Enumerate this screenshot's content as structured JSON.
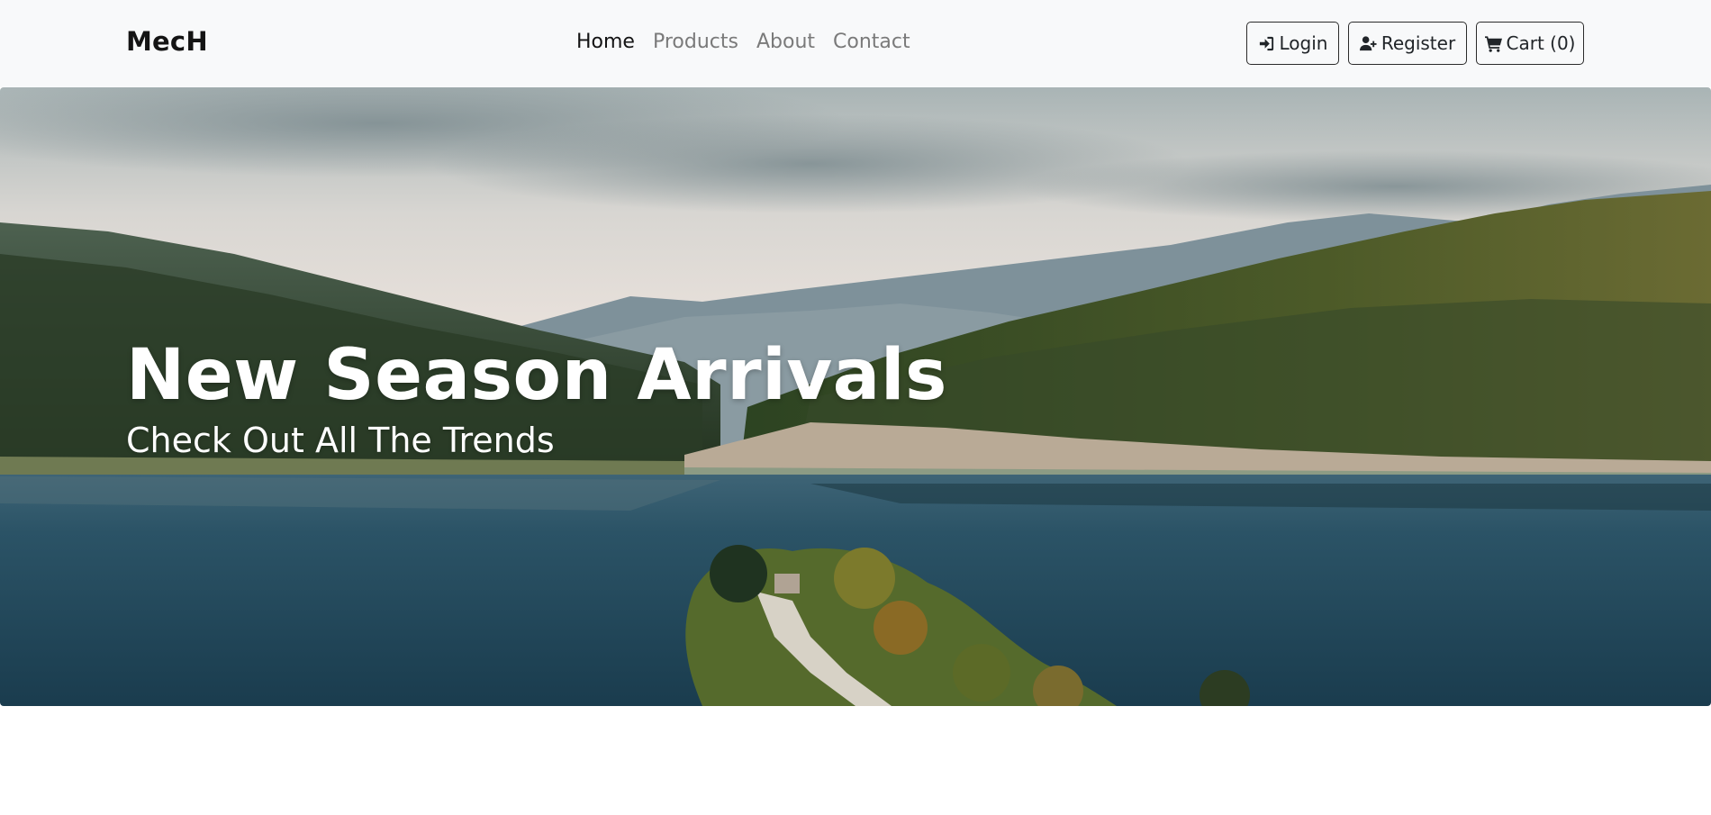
{
  "navbar": {
    "brand": "MecH",
    "links": [
      {
        "label": "Home",
        "active": true
      },
      {
        "label": "Products",
        "active": false
      },
      {
        "label": "About",
        "active": false
      },
      {
        "label": "Contact",
        "active": false
      }
    ],
    "buttons": {
      "login": {
        "label": "Login",
        "icon": "sign-in-icon"
      },
      "register": {
        "label": "Register",
        "icon": "user-plus-icon"
      },
      "cart": {
        "label": "Cart (0)",
        "icon": "shopping-cart-icon"
      }
    },
    "background_color": "#f8f9fa"
  },
  "hero": {
    "title": "New Season Arrivals",
    "subtitle": "Check Out All The Trends",
    "image_description_icon": "landscape-photo",
    "colors": {
      "sky": "#dcdcd8",
      "mountain": "#7c8f98",
      "forest": "#2f4423",
      "lake": "#224a5e"
    }
  }
}
